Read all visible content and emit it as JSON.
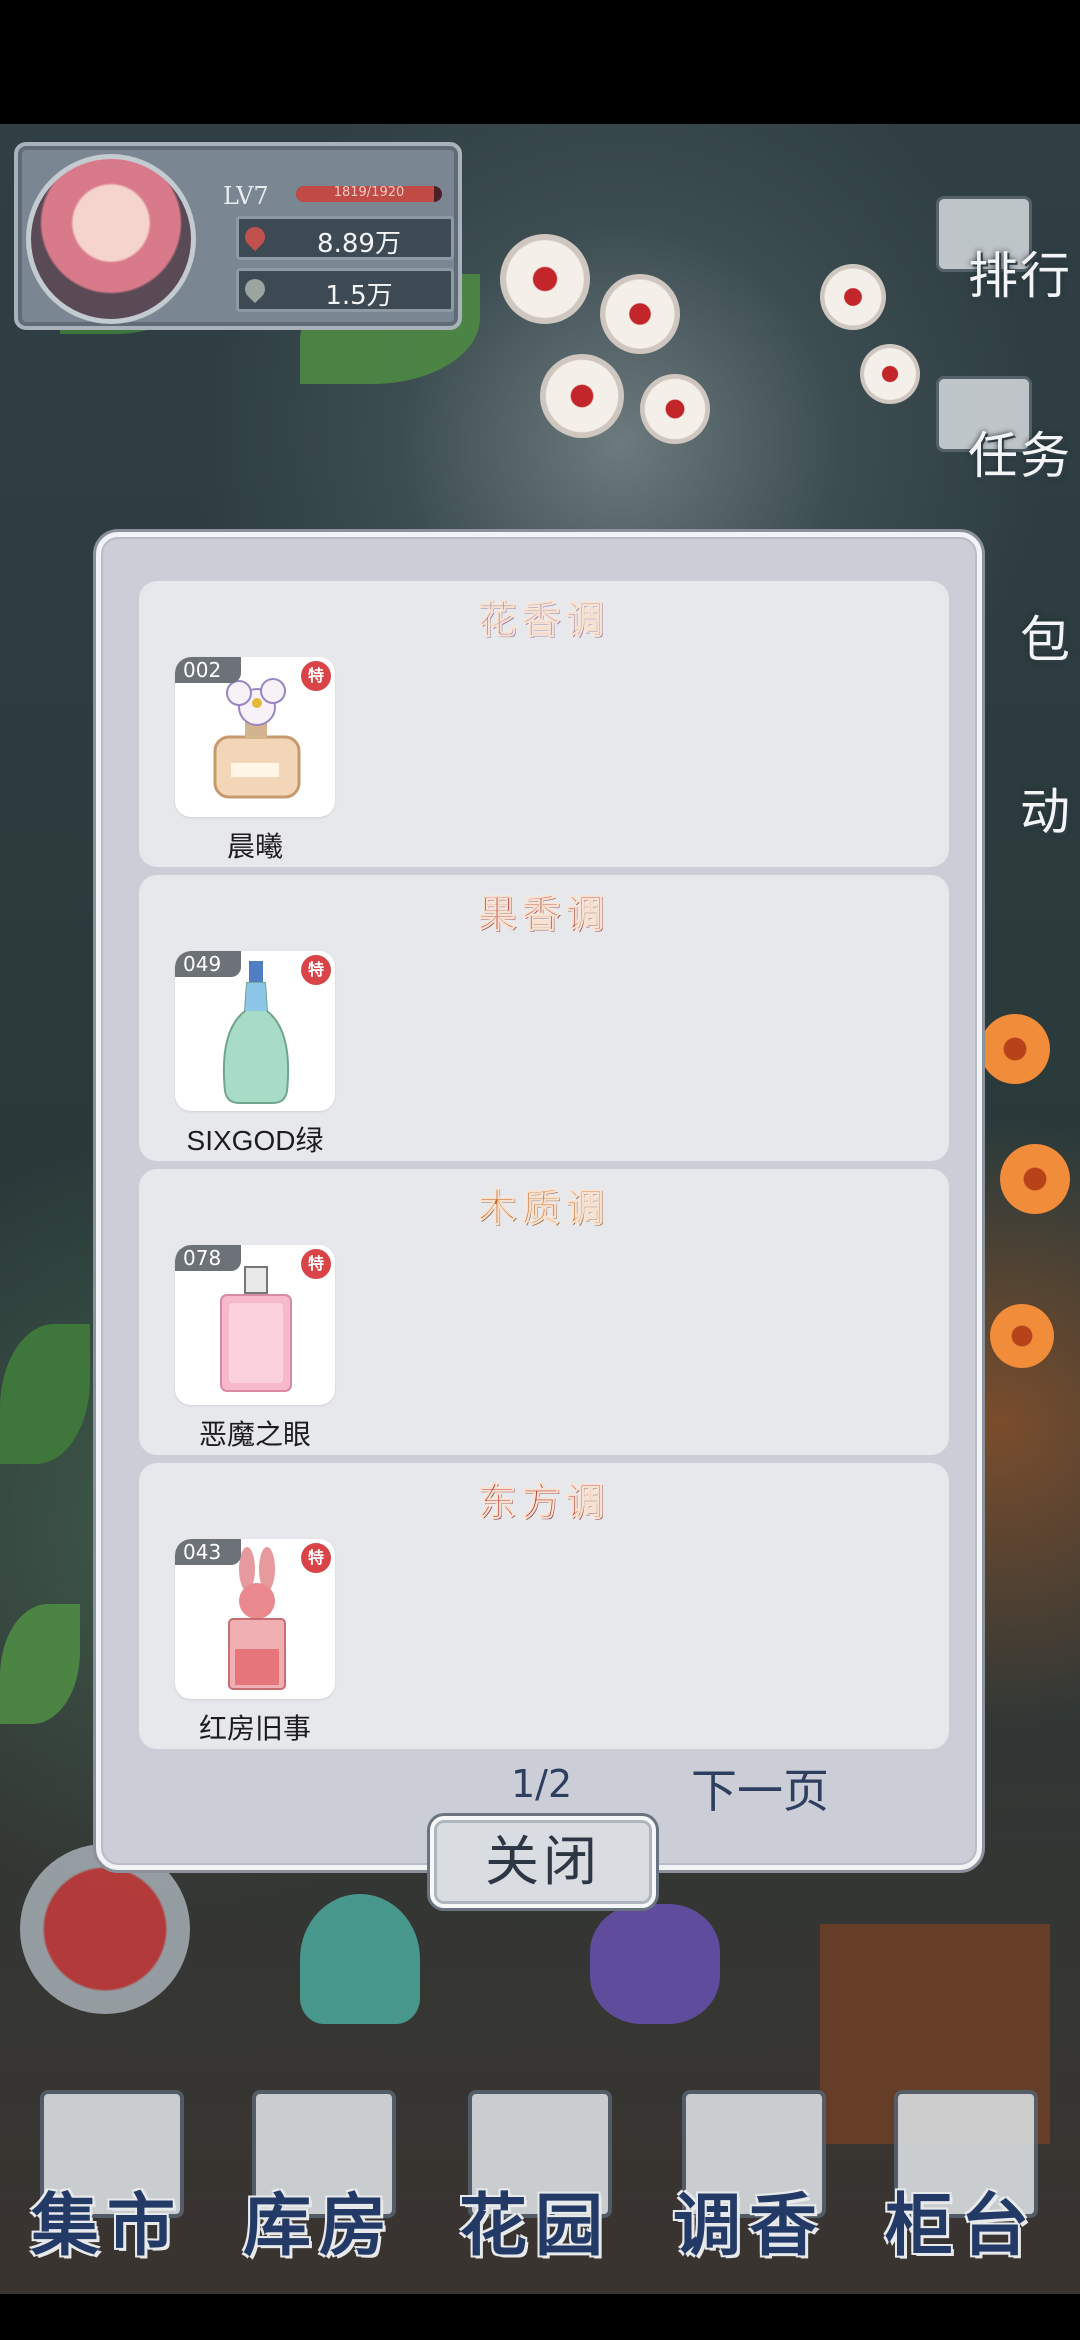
{
  "player": {
    "level": "LV7",
    "xp_text": "1819/1920",
    "xp_progress": 0.947,
    "currency_1": "8.89万",
    "currency_2": "1.5万"
  },
  "side_menu": [
    {
      "label": "排行",
      "icon": "trophy-icon"
    },
    {
      "label": "任务",
      "icon": "clipboard-icon"
    },
    {
      "label": "包",
      "icon": "bag-icon"
    },
    {
      "label": "动",
      "icon": "activity-icon"
    }
  ],
  "modal": {
    "sections": [
      {
        "title": "花香调",
        "item": {
          "number": "002",
          "tag": "特",
          "name": "晨曦"
        }
      },
      {
        "title": "果香调",
        "item": {
          "number": "049",
          "tag": "特",
          "name": "SIXGOD绿"
        }
      },
      {
        "title": "木质调",
        "item": {
          "number": "078",
          "tag": "特",
          "name": "恶魔之眼"
        }
      },
      {
        "title": "东方调",
        "item": {
          "number": "043",
          "tag": "特",
          "name": "红房旧事"
        }
      }
    ],
    "page_indicator": "1/2",
    "next_page": "下一页",
    "close": "关闭"
  },
  "bottom_nav": [
    {
      "label": "集市"
    },
    {
      "label": "库房"
    },
    {
      "label": "花园"
    },
    {
      "label": "调香"
    },
    {
      "label": "柜台"
    }
  ],
  "colors": {
    "section_title_red": "#bb2f33",
    "badge_red": "#d94448",
    "nav_text": "#243a66",
    "modal_bg": "#cbced6"
  }
}
